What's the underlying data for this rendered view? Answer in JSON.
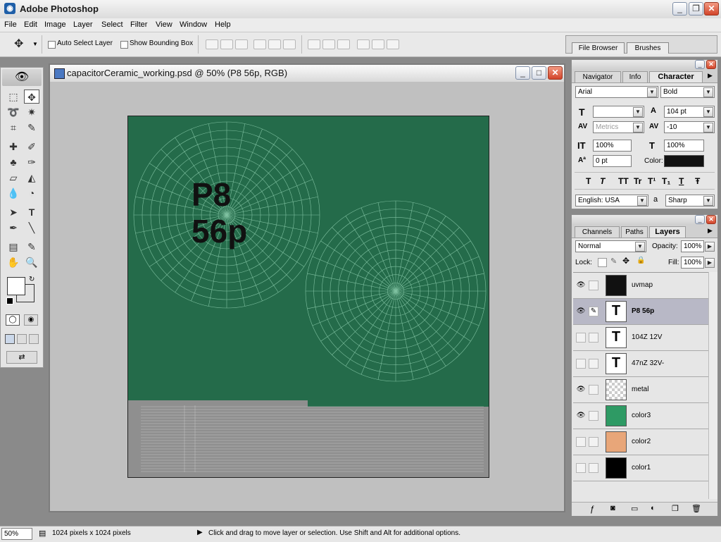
{
  "app": {
    "title": "Adobe Photoshop"
  },
  "menu": [
    "File",
    "Edit",
    "Image",
    "Layer",
    "Select",
    "Filter",
    "View",
    "Window",
    "Help"
  ],
  "options": {
    "auto_select_label": "Auto Select Layer",
    "bounding_box_label": "Show Bounding Box"
  },
  "palette_well": {
    "tabs": [
      "File Browser",
      "Brushes"
    ]
  },
  "document": {
    "title": "capacitorCeramic_working.psd @ 50% (P8 56p, RGB)",
    "canvas_text_line1": "P8",
    "canvas_text_line2": "56p",
    "canvas_color": "#246b4a",
    "metal_color": "#8f8f8f"
  },
  "character_panel": {
    "tabs": [
      "Navigator",
      "Info",
      "Character"
    ],
    "font_family": "Arial",
    "font_style": "Bold",
    "font_size": "",
    "leading": "104 pt",
    "kerning": "Metrics",
    "tracking": "-10",
    "vertical_scale": "100%",
    "horizontal_scale": "100%",
    "baseline_shift": "0 pt",
    "color_label": "Color:",
    "color": "#111111",
    "style_buttons": [
      "T",
      "T",
      "TT",
      "Tr",
      "T¹",
      "T₁",
      "T",
      "Ŧ"
    ],
    "language": "English: USA",
    "aa_label": "a",
    "antialias": "Sharp"
  },
  "layers_panel": {
    "tabs": [
      "Channels",
      "Paths",
      "Layers"
    ],
    "blend_mode": "Normal",
    "opacity_label": "Opacity:",
    "opacity": "100%",
    "lock_label": "Lock:",
    "fill_label": "Fill:",
    "fill": "100%",
    "layers": [
      {
        "name": "uvmap",
        "visible": true,
        "kind": "uvmap"
      },
      {
        "name": "P8 56p",
        "visible": true,
        "kind": "text",
        "selected": true
      },
      {
        "name": "104Z 12V",
        "visible": false,
        "kind": "text"
      },
      {
        "name": "47nZ 32V-",
        "visible": false,
        "kind": "text"
      },
      {
        "name": "metal",
        "visible": true,
        "kind": "transparent"
      },
      {
        "name": "color3",
        "visible": true,
        "kind": "color",
        "color": "#2e9a64"
      },
      {
        "name": "color2",
        "visible": false,
        "kind": "color",
        "color": "#e8a679"
      },
      {
        "name": "color1",
        "visible": false,
        "kind": "color",
        "color": "#000000"
      }
    ]
  },
  "status": {
    "zoom": "50%",
    "doc_size": "1024 pixels x 1024 pixels",
    "hint": "Click and drag to move layer or selection.  Use Shift and Alt for additional options."
  },
  "colors": {
    "foreground": "#ffffff",
    "background": "#ffffff"
  }
}
